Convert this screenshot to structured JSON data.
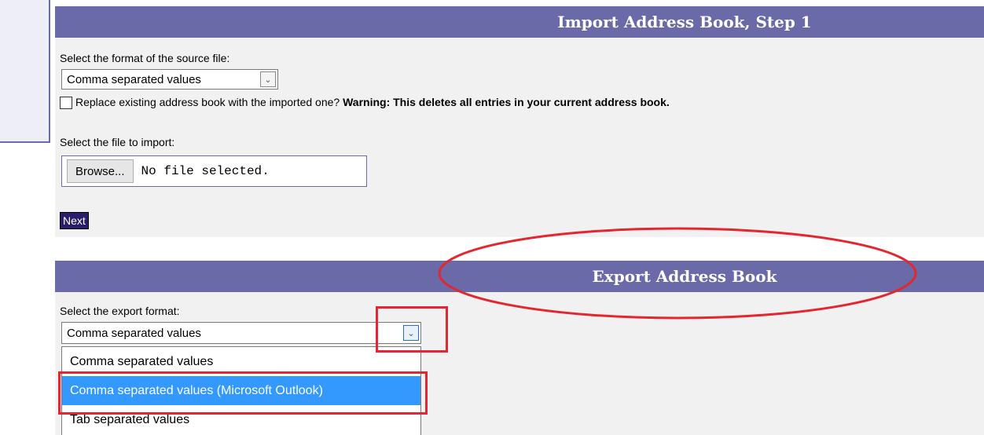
{
  "import": {
    "title": "Import Address Book, Step 1",
    "format_label": "Select the format of the source file:",
    "format_selected": "Comma separated values",
    "replace_label": "Replace existing address book with the imported one? ",
    "replace_warning": "Warning: This deletes all entries in your current address book.",
    "file_label": "Select the file to import:",
    "browse_label": "Browse...",
    "file_status": "No file selected.",
    "next_label": "Next"
  },
  "export": {
    "title": "Export Address Book",
    "format_label": "Select the export format:",
    "format_selected": "Comma separated values",
    "options": [
      "Comma separated values",
      "Comma separated values (Microsoft Outlook)",
      "Tab separated values"
    ],
    "highlighted_option_index": 1
  },
  "colors": {
    "header": "#6b6aa8",
    "annotation": "#e3262f",
    "highlight": "#3399ff"
  }
}
